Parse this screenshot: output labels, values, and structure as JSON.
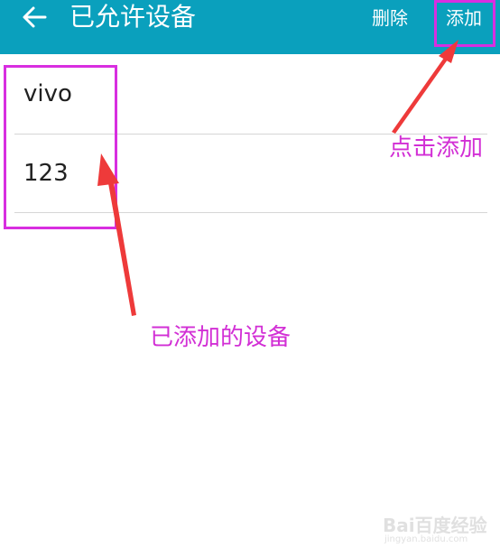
{
  "app_bar": {
    "title": "已允许设备",
    "back_icon": "arrow-left-icon",
    "actions": {
      "delete_label": "删除",
      "add_label": "添加"
    },
    "background_color": "#0aa0bd"
  },
  "device_list": {
    "items": [
      {
        "label": "vivo"
      },
      {
        "label": "123"
      }
    ]
  },
  "annotations": {
    "click_add_note": "点击添加",
    "added_devices_note": "已添加的设备",
    "highlight_color": "#d82ee0"
  },
  "watermark": {
    "brand": "Bai百度经验",
    "url": "jingyan.baidu.com"
  }
}
